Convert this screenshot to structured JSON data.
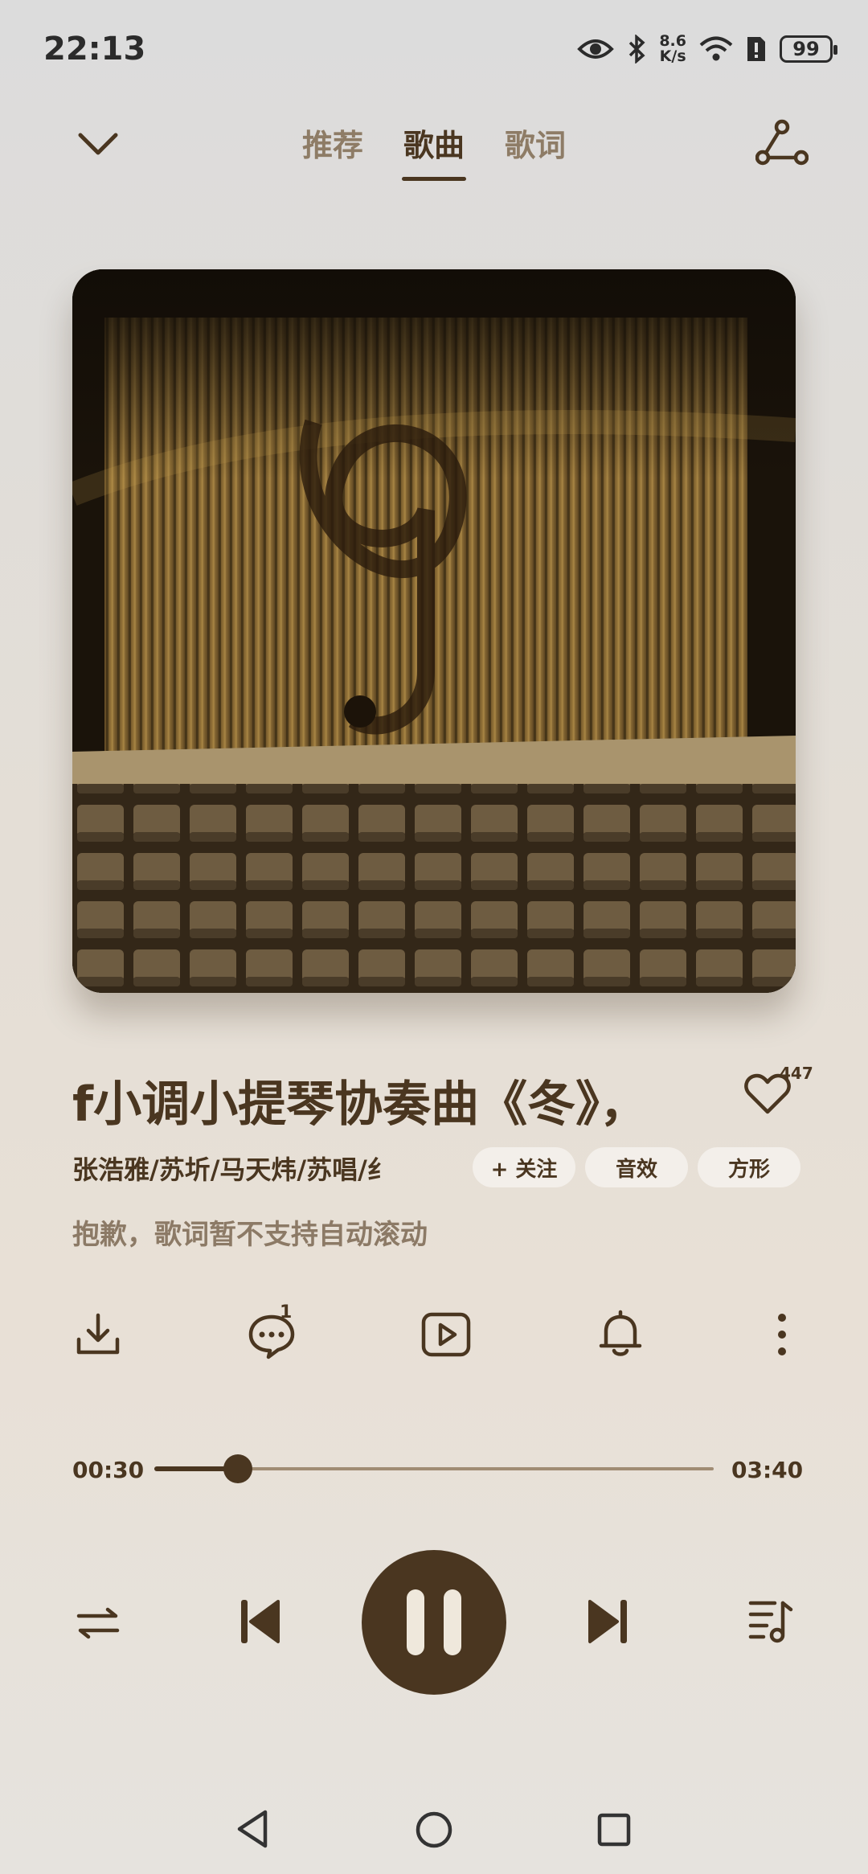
{
  "status_bar": {
    "time": "22:13",
    "net_speed_value": "8.6",
    "net_speed_unit": "K/s",
    "battery": "99"
  },
  "tabs": [
    {
      "label": "推荐",
      "active": false
    },
    {
      "label": "歌曲",
      "active": true
    },
    {
      "label": "歌词",
      "active": false
    }
  ],
  "song": {
    "title": "f小调小提琴协奏曲《冬》，",
    "artists": "张浩雅/苏圻/马天炜/苏唱/纟",
    "like_count": "447",
    "lyrics_hint": "抱歉，歌词暂不支持自动滚动"
  },
  "chips": {
    "follow": "+ 关注",
    "effect": "音效",
    "shape": "方形"
  },
  "comment_badge": "1",
  "progress": {
    "current": "00:30",
    "total": "03:40",
    "fraction": 0.15
  },
  "icons": [
    "collapse-chevron-icon",
    "share-icon",
    "heart-icon",
    "download-icon",
    "comment-icon",
    "video-icon",
    "bell-icon",
    "more-icon",
    "repeat-icon",
    "previous-icon",
    "pause-icon",
    "next-icon",
    "playlist-icon",
    "back-nav-icon",
    "home-nav-icon",
    "recents-nav-icon"
  ],
  "colors": {
    "accent": "#4a3620",
    "muted": "#8c7a66"
  }
}
